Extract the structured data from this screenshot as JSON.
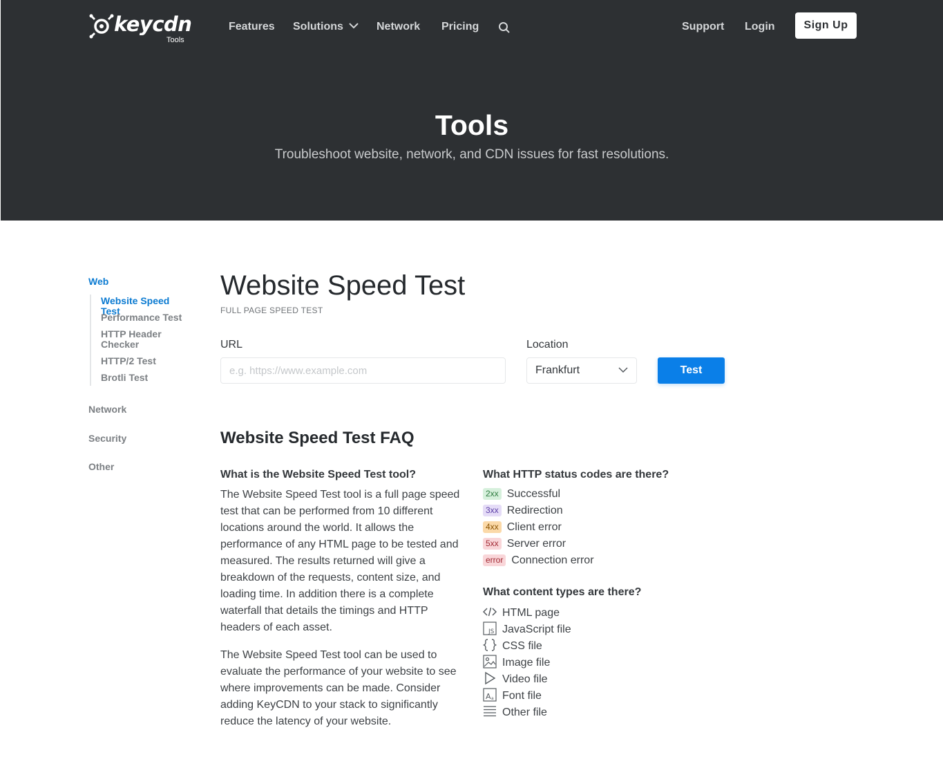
{
  "brand": {
    "name": "keycdn",
    "sub": "Tools"
  },
  "nav": {
    "features": "Features",
    "solutions": "Solutions",
    "network": "Network",
    "pricing": "Pricing",
    "support": "Support",
    "login": "Login",
    "signup": "Sign Up"
  },
  "hero": {
    "title": "Tools",
    "subtitle": "Troubleshoot website, network, and CDN issues for fast resolutions."
  },
  "sidebar": {
    "web": "Web",
    "items": [
      {
        "label": "Website Speed Test",
        "active": true
      },
      {
        "label": "Performance Test"
      },
      {
        "label": "HTTP Header Checker"
      },
      {
        "label": "HTTP/2 Test"
      },
      {
        "label": "Brotli Test"
      }
    ],
    "network": "Network",
    "security": "Security",
    "other": "Other"
  },
  "main": {
    "title": "Website Speed Test",
    "kicker": "FULL PAGE SPEED TEST",
    "url_label": "URL",
    "url_placeholder": "e.g. https://www.example.com",
    "location_label": "Location",
    "location_value": "Frankfurt",
    "test_button": "Test"
  },
  "faq": {
    "title": "Website Speed Test FAQ",
    "q1": "What is the Website Speed Test tool?",
    "p1": "The Website Speed Test tool is a full page speed test that can be performed from 10 different locations around the world. It allows the performance of any HTML page to be tested and measured. The results returned will give a breakdown of the requests, content size, and loading time. In addition there is a complete waterfall that details the timings and HTTP headers of each asset.",
    "p2": "The Website Speed Test tool can be used to evaluate the performance of your website to see where improvements can be made. Consider adding KeyCDN to your stack to significantly reduce the latency of your website.",
    "q2": "What HTTP status codes are there?",
    "status_codes": [
      {
        "code": "2xx",
        "label": "Successful",
        "bg": "#d6f0dc",
        "fg": "#2c7a3e"
      },
      {
        "code": "3xx",
        "label": "Redirection",
        "bg": "#e5dcf7",
        "fg": "#5b3fa6"
      },
      {
        "code": "4xx",
        "label": "Client error",
        "bg": "#fbd9a8",
        "fg": "#8a5200"
      },
      {
        "code": "5xx",
        "label": "Server error",
        "bg": "#f9d6d9",
        "fg": "#a12a34"
      },
      {
        "code": "error",
        "label": "Connection error",
        "bg": "#f9d6d9",
        "fg": "#a12a34"
      }
    ],
    "q3": "What content types are there?",
    "content_types": [
      {
        "icon": "code-icon",
        "label": "HTML page"
      },
      {
        "icon": "js-file-icon",
        "label": "JavaScript file"
      },
      {
        "icon": "braces-icon",
        "label": "CSS file"
      },
      {
        "icon": "image-icon",
        "label": "Image file"
      },
      {
        "icon": "play-icon",
        "label": "Video file"
      },
      {
        "icon": "font-icon",
        "label": "Font file"
      },
      {
        "icon": "lines-icon",
        "label": "Other file"
      }
    ]
  },
  "colors": {
    "hero_bg": "#2d3033",
    "accent": "#0a7fe8",
    "sidebar_active": "#0a7ad1"
  }
}
